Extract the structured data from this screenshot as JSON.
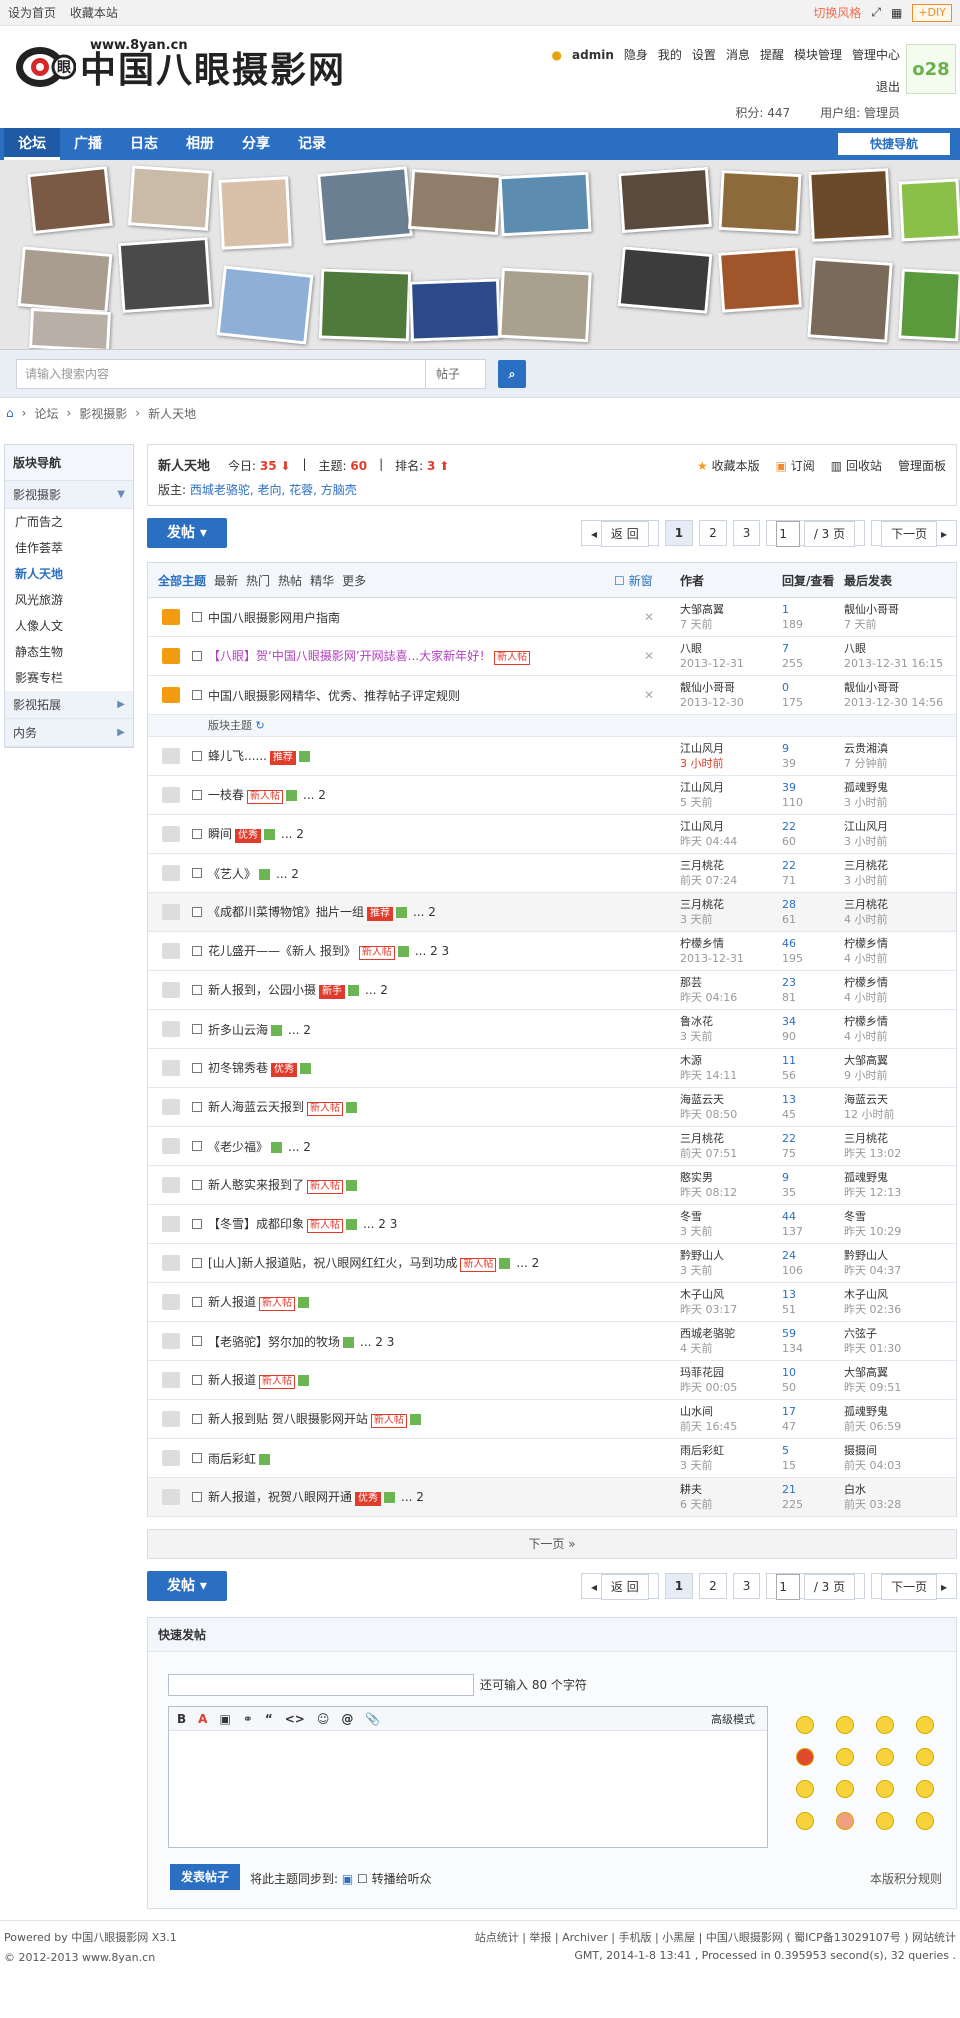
{
  "topbar": {
    "set_home": "设为首页",
    "bookmark": "收藏本站",
    "switch_style": "切换风格",
    "diy": "+DIY"
  },
  "logo": {
    "site_url": "www.8yan.cn",
    "site_name": "中国八眼摄影网",
    "eye_char": "眼"
  },
  "user": {
    "name": "admin",
    "stealth": "隐身",
    "mine": "我的",
    "settings": "设置",
    "messages": "消息",
    "remind": "提醒",
    "module_mgr": "模块管理",
    "admin_center": "管理中心",
    "logout": "退出",
    "credits": "积分: 447",
    "group": "用户组: 管理员",
    "avatar": "o28"
  },
  "nav": {
    "items": [
      "论坛",
      "广播",
      "日志",
      "相册",
      "分享",
      "记录"
    ],
    "quick": "快捷导航"
  },
  "search": {
    "placeholder": "请输入搜索内容",
    "type": "帖子"
  },
  "breadcrumb": [
    "论坛",
    "影视摄影",
    "新人天地"
  ],
  "sidebar": {
    "title": "版块导航",
    "group1": "影视摄影",
    "items": [
      "广而告之",
      "佳作荟萃",
      "新人天地",
      "风光旅游",
      "人像人文",
      "静态生物",
      "影赛专栏"
    ],
    "group2": "影视拓展",
    "group3": "内务"
  },
  "forum": {
    "title": "新人天地",
    "today_label": "今日:",
    "today": "35",
    "topics_label": "主题:",
    "topics": "60",
    "rank_label": "排名:",
    "rank": "3",
    "mods_label": "版主:",
    "mods": "西城老骆驼, 老向, 花蓉, 方脑壳",
    "actions": [
      "收藏本版",
      "订阅",
      "回收站",
      "管理面板"
    ]
  },
  "pager": {
    "post": "发帖",
    "back": "返 回",
    "pages": [
      "1",
      "2",
      "3"
    ],
    "input": "1",
    "total": "/ 3 页",
    "next": "下一页",
    "next_page_bar": "下一页 »"
  },
  "table": {
    "tabs": [
      "全部主题",
      "最新",
      "热门",
      "热帖",
      "精华",
      "更多"
    ],
    "new_window": "新窗",
    "col_author": "作者",
    "col_reply": "回复/查看",
    "col_last": "最后发表",
    "sep": "版块主题"
  },
  "sticky": [
    {
      "title": "中国八眼摄影网用户指南",
      "author": "大邹高翼",
      "date": "7 天前",
      "replies": "1",
      "views": "189",
      "last": "靓仙小哥哥",
      "last_date": "7 天前"
    },
    {
      "title": "【八眼】贺‘中国八眼摄影网’开网誌喜...大家新年好！",
      "author": "八眼",
      "date": "2013-12-31",
      "replies": "7",
      "views": "255",
      "last": "八眼",
      "last_date": "2013-12-31 16:15",
      "tag": "新人帖"
    },
    {
      "title": "中国八眼摄影网精华、优秀、推荐帖子评定规则",
      "author": "靓仙小哥哥",
      "date": "2013-12-30",
      "replies": "0",
      "views": "175",
      "last": "靓仙小哥哥",
      "last_date": "2013-12-30 14:56"
    }
  ],
  "threads": [
    {
      "title": "蜂儿飞......",
      "tag": "推荐",
      "pages": "",
      "author": "江山风月",
      "date": "3 小时前",
      "replies": "9",
      "views": "39",
      "last": "云贵湘滇",
      "last_date": "7 分钟前"
    },
    {
      "title": "一枝春",
      "tag": "新人帖",
      "pages": "... 2",
      "author": "江山风月",
      "date": "5 天前",
      "replies": "39",
      "views": "110",
      "last": "孤魂野鬼",
      "last_date": "3 小时前"
    },
    {
      "title": "瞬间",
      "tag": "优秀",
      "pages": "... 2",
      "author": "江山风月",
      "date": "昨天 04:44",
      "replies": "22",
      "views": "60",
      "last": "江山风月",
      "last_date": "3 小时前"
    },
    {
      "title": "《艺人》",
      "tag": "",
      "pages": "... 2",
      "author": "三月桃花",
      "date": "前天 07:24",
      "replies": "22",
      "views": "71",
      "last": "三月桃花",
      "last_date": "3 小时前"
    },
    {
      "title": "《成都川菜博物馆》拙片一组",
      "tag": "推荐",
      "pages": "... 2",
      "author": "三月桃花",
      "date": "3 天前",
      "replies": "28",
      "views": "61",
      "last": "三月桃花",
      "last_date": "4 小时前"
    },
    {
      "title": "花儿盛开——《新人 报到》",
      "tag": "新人帖",
      "pages": "... 2  3",
      "author": "柠檬乡情",
      "date": "2013-12-31",
      "replies": "46",
      "views": "195",
      "last": "柠檬乡情",
      "last_date": "4 小时前"
    },
    {
      "title": "新人报到，公园小摄",
      "tag": "新手",
      "pages": "... 2",
      "author": "那芸",
      "date": "昨天 04:16",
      "replies": "23",
      "views": "81",
      "last": "柠檬乡情",
      "last_date": "4 小时前"
    },
    {
      "title": "折多山云海",
      "tag": "",
      "pages": "... 2",
      "author": "鲁冰花",
      "date": "3 天前",
      "replies": "34",
      "views": "90",
      "last": "柠檬乡情",
      "last_date": "4 小时前"
    },
    {
      "title": "初冬锦秀巷",
      "tag": "优秀",
      "pages": "",
      "author": "木源",
      "date": "昨天 14:11",
      "replies": "11",
      "views": "56",
      "last": "大邹高翼",
      "last_date": "9 小时前"
    },
    {
      "title": "新人海蓝云天报到",
      "tag": "新人帖",
      "pages": "",
      "author": "海蓝云天",
      "date": "昨天 08:50",
      "replies": "13",
      "views": "45",
      "last": "海蓝云天",
      "last_date": "12 小时前"
    },
    {
      "title": "《老少福》",
      "tag": "",
      "pages": "... 2",
      "author": "三月桃花",
      "date": "前天 07:51",
      "replies": "22",
      "views": "75",
      "last": "三月桃花",
      "last_date": "昨天 13:02"
    },
    {
      "title": "新人憨实来报到了",
      "tag": "新人帖",
      "pages": "",
      "author": "憨实男",
      "date": "昨天 08:12",
      "replies": "9",
      "views": "35",
      "last": "孤魂野鬼",
      "last_date": "昨天 12:13"
    },
    {
      "title": "【冬雪】成都印象",
      "tag": "新人帖",
      "pages": "... 2  3",
      "author": "冬雪",
      "date": "3 天前",
      "replies": "44",
      "views": "137",
      "last": "冬雪",
      "last_date": "昨天 10:29"
    },
    {
      "title": "[山人]新人报道贴，祝八眼网红红火，马到功成",
      "tag": "新人帖",
      "pages": "... 2",
      "author": "黔野山人",
      "date": "3 天前",
      "replies": "24",
      "views": "106",
      "last": "黔野山人",
      "last_date": "昨天 04:37"
    },
    {
      "title": "新人报道",
      "tag": "新人帖",
      "pages": "",
      "author": "木子山风",
      "date": "昨天 03:17",
      "replies": "13",
      "views": "51",
      "last": "木子山风",
      "last_date": "昨天 02:36"
    },
    {
      "title": "【老骆驼】努尔加的牧场",
      "tag": "",
      "pages": "... 2  3",
      "author": "西城老骆驼",
      "date": "4 天前",
      "replies": "59",
      "views": "134",
      "last": "六弦子",
      "last_date": "昨天 01:30"
    },
    {
      "title": "新人报道",
      "tag": "新人帖",
      "pages": "",
      "author": "玛菲花园",
      "date": "昨天 00:05",
      "replies": "10",
      "views": "50",
      "last": "大邹高翼",
      "last_date": "昨天 09:51"
    },
    {
      "title": "新人报到贴 贺八眼摄影网开站",
      "tag": "新人帖",
      "pages": "",
      "author": "山水间",
      "date": "前天 16:45",
      "replies": "17",
      "views": "47",
      "last": "孤魂野鬼",
      "last_date": "前天 06:59"
    },
    {
      "title": "雨后彩虹",
      "tag": "",
      "pages": "",
      "author": "雨后彩虹",
      "date": "3 天前",
      "replies": "5",
      "views": "15",
      "last": "摄摄间",
      "last_date": "前天 04:03"
    },
    {
      "title": "新人报道，祝贺八眼网开通",
      "tag": "优秀",
      "pages": "... 2",
      "author": "耕夫",
      "date": "6 天前",
      "replies": "21",
      "views": "225",
      "last": "白水",
      "last_date": "前天 03:28"
    }
  ],
  "quickpost": {
    "title": "快速发帖",
    "hint": "还可输入 80 个字符",
    "tools": [
      "B",
      "A",
      "▣",
      "⚭",
      "“",
      "<>",
      "☺",
      "@",
      "📎"
    ],
    "advanced": "高级模式",
    "submit": "发表帖子",
    "sync": "将此主题同步到:",
    "broadcast": "转播给听众",
    "rules": "本版积分规则"
  },
  "footer": {
    "powered": "Powered by 中国八眼摄影网 X3.1",
    "copyright": "© 2012-2013 www.8yan.cn",
    "links": "站点统计 | 举报 | Archiver | 手机版 | 小黑屋 | 中国八眼摄影网 ( 蜀ICP备13029107号 )  网站统计",
    "gmt": "GMT, 2014-1-8 13:41 , Processed in 0.395953 second(s), 32 queries ."
  },
  "colors": {
    "brand": "#2b6fc2",
    "accent_red": "#e03c2c",
    "style_link": "#f26c4f"
  }
}
